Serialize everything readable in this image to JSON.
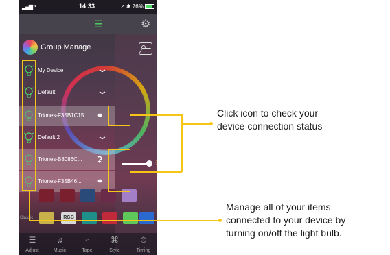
{
  "status": {
    "signal": "▂▄▆ ◔",
    "time": "14:33",
    "battery": "↗ ✱ 76%"
  },
  "group": {
    "title": "Group Manage"
  },
  "rows": [
    {
      "label": "My Device",
      "type": "group"
    },
    {
      "label": "Default",
      "type": "group"
    },
    {
      "label": "Triones-F35B1C15",
      "type": "device"
    },
    {
      "label": "Default 2",
      "type": "group"
    },
    {
      "label": "Triones-B8086C...",
      "type": "device"
    },
    {
      "label": "Triones-F35B46...",
      "type": "device"
    }
  ],
  "rgb_label": "RGB",
  "classic_label": "Classic",
  "tabs": [
    {
      "label": "Adjust",
      "icon": "sliders-icon"
    },
    {
      "label": "Music",
      "icon": "music-icon"
    },
    {
      "label": "Tape",
      "icon": "tape-icon"
    },
    {
      "label": "Style",
      "icon": "style-icon"
    },
    {
      "label": "Timing",
      "icon": "timer-icon"
    }
  ],
  "callouts": {
    "connection": [
      "Click icon to check your",
      "device connection status"
    ],
    "bulbs": [
      "Manage all of your items",
      "connected to your device by",
      "turning on/off the light bulb."
    ]
  },
  "colors": {
    "accent": "#f5c518",
    "bulb_on": "#4cd964"
  }
}
